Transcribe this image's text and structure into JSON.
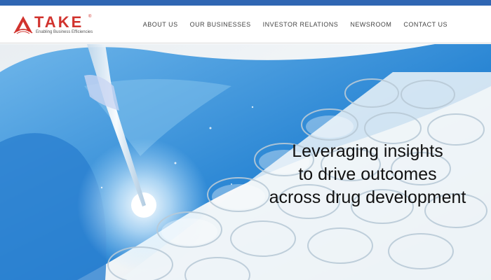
{
  "brand": {
    "name": "TAKE",
    "registered": "®",
    "tagline": "Enabling Business Efficiencies",
    "colors": {
      "logo": "#d1332e",
      "top_bar": "#2f66b3"
    }
  },
  "nav": {
    "items": [
      "ABOUT US",
      "OUR BUSINESSES",
      "INVESTOR RELATIONS",
      "NEWSROOM",
      "CONTACT US"
    ]
  },
  "hero": {
    "headline_lines": [
      "Leveraging insights",
      "to drive outcomes",
      "across drug development"
    ],
    "image": "lab-pipette-well-plate"
  }
}
